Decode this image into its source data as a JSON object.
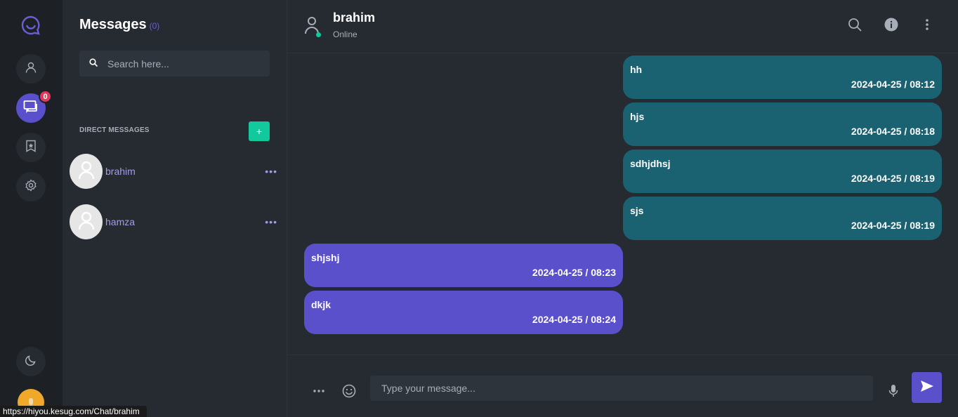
{
  "rail": {
    "notifications_badge": "0"
  },
  "list": {
    "title": "Messages",
    "count": "(0)",
    "search_placeholder": "Search here...",
    "direct_messages_label": "DIRECT MESSAGES",
    "add_label": "+",
    "contacts": [
      {
        "name": "brahim"
      },
      {
        "name": "hamza"
      }
    ]
  },
  "chat": {
    "name": "brahim",
    "status": "Online",
    "messages": [
      {
        "direction": "out",
        "text": "hh",
        "time": "2024-04-25 / 08:12"
      },
      {
        "direction": "out",
        "text": "hjs",
        "time": "2024-04-25 / 08:18"
      },
      {
        "direction": "out",
        "text": "sdhjdhsj",
        "time": "2024-04-25 / 08:19"
      },
      {
        "direction": "out",
        "text": "sjs",
        "time": "2024-04-25 / 08:19"
      },
      {
        "direction": "in",
        "text": "shjshj",
        "time": "2024-04-25 / 08:23"
      },
      {
        "direction": "in",
        "text": "dkjk",
        "time": "2024-04-25 / 08:24"
      }
    ],
    "input_placeholder": "Type your message..."
  },
  "status_bar": {
    "url": "https://hiyou.kesug.com/Chat/brahim"
  },
  "colors": {
    "accent": "#5b50cc",
    "outgoing_bubble": "#1a6271",
    "online": "#11c99d",
    "badge": "#e2385b"
  },
  "icons": [
    "chat-logo-icon",
    "user-icon",
    "messages-icon",
    "bookmark-icon",
    "settings-icon",
    "moon-icon",
    "search-icon",
    "info-icon",
    "more-vertical-icon",
    "more-horizontal-icon",
    "emoji-icon",
    "microphone-icon",
    "send-icon"
  ]
}
